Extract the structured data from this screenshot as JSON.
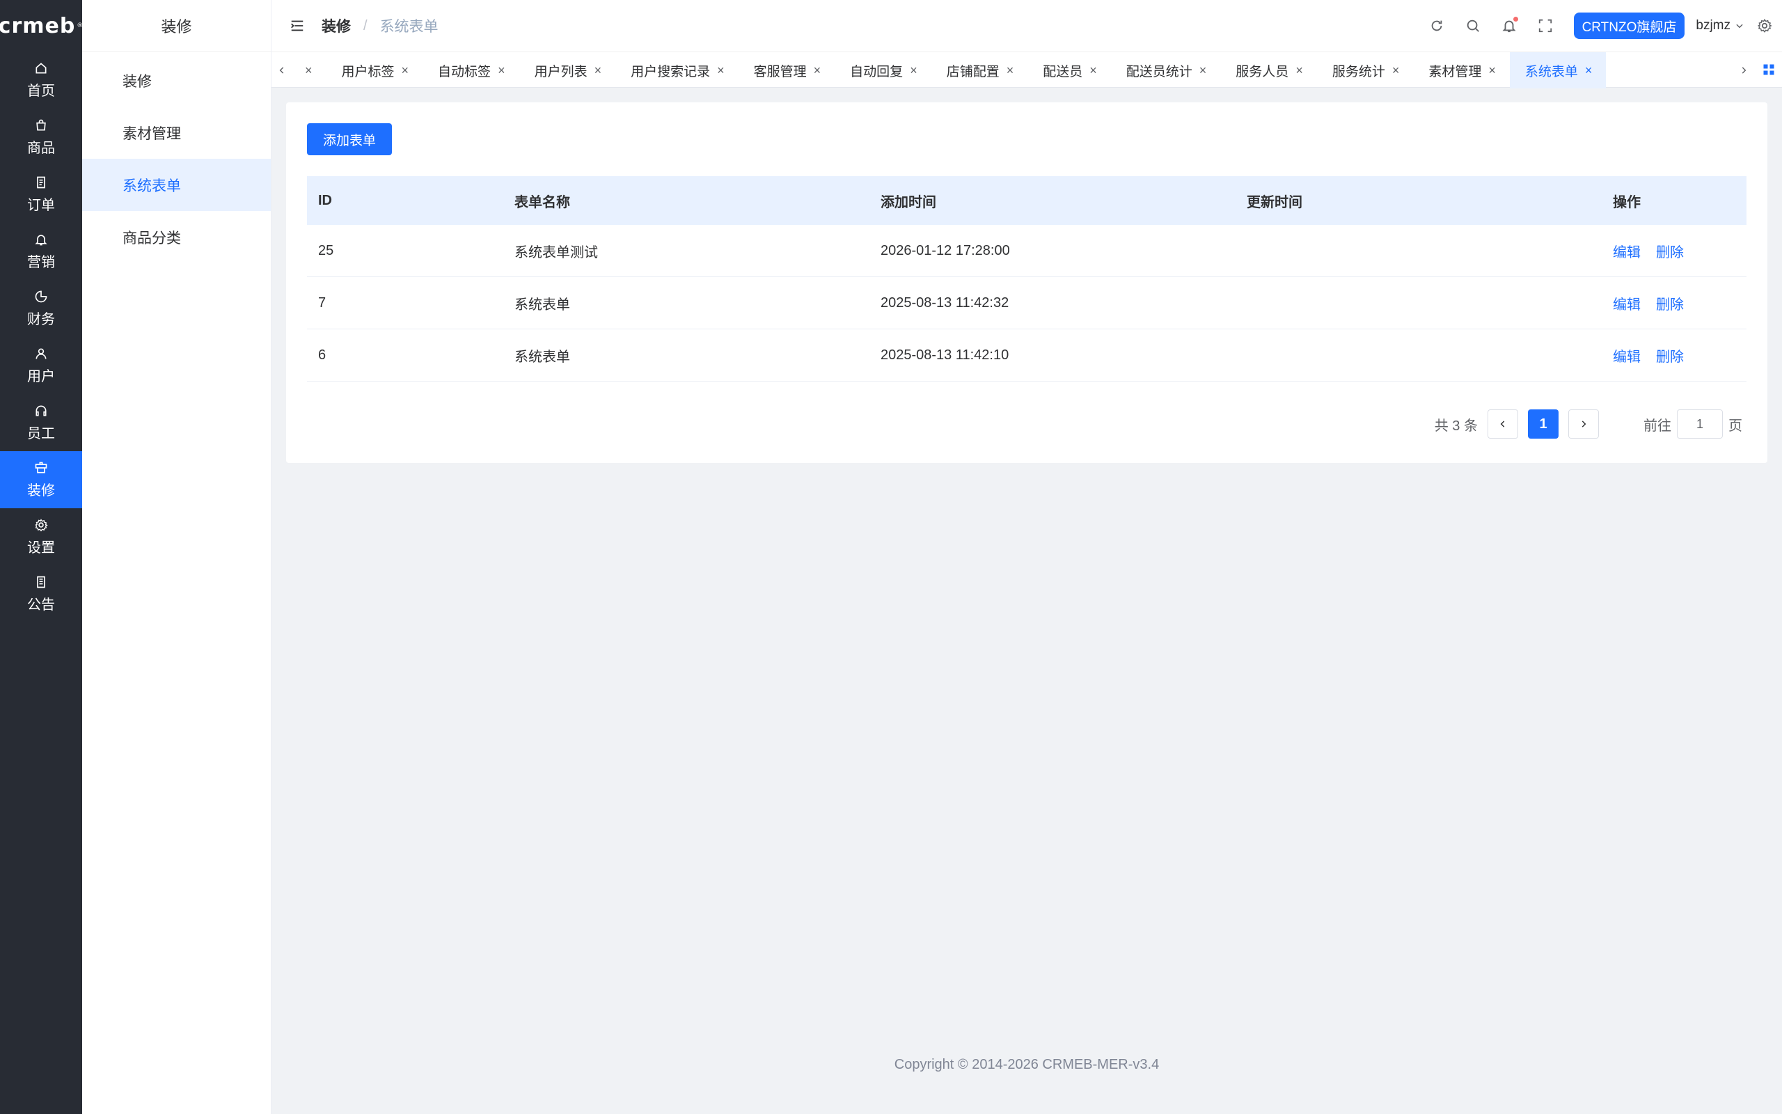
{
  "logo": {
    "text": "crmeb",
    "mark": "®"
  },
  "nav": [
    {
      "label": "首页",
      "icon": "home-icon"
    },
    {
      "label": "商品",
      "icon": "bag-icon"
    },
    {
      "label": "订单",
      "icon": "order-icon"
    },
    {
      "label": "营销",
      "icon": "bell-icon"
    },
    {
      "label": "财务",
      "icon": "pie-icon"
    },
    {
      "label": "用户",
      "icon": "user-icon"
    },
    {
      "label": "员工",
      "icon": "headset-icon"
    },
    {
      "label": "装修",
      "icon": "decor-icon",
      "active": true
    },
    {
      "label": "设置",
      "icon": "gear-icon"
    },
    {
      "label": "公告",
      "icon": "notice-icon"
    }
  ],
  "subnav": {
    "title": "装修",
    "items": [
      "装修",
      "素材管理",
      "系统表单",
      "商品分类"
    ],
    "active": "系统表单"
  },
  "breadcrumb": {
    "parent": "装修",
    "separator": "/",
    "current": "系统表单"
  },
  "header": {
    "store": "CRTNZO旗舰店",
    "user": "bzjmz"
  },
  "tabs": [
    "",
    "用户标签",
    "自动标签",
    "用户列表",
    "用户搜索记录",
    "客服管理",
    "自动回复",
    "店铺配置",
    "配送员",
    "配送员统计",
    "服务人员",
    "服务统计",
    "素材管理",
    "系统表单"
  ],
  "active_tab": "系统表单",
  "add_button": "添加表单",
  "table": {
    "headers": [
      "ID",
      "表单名称",
      "添加时间",
      "更新时间",
      "操作"
    ],
    "rows": [
      {
        "id": "25",
        "name": "系统表单测试",
        "created": "2026-01-12 17:28:00",
        "updated": ""
      },
      {
        "id": "7",
        "name": "系统表单",
        "created": "2025-08-13 11:42:32",
        "updated": ""
      },
      {
        "id": "6",
        "name": "系统表单",
        "created": "2025-08-13 11:42:10",
        "updated": ""
      }
    ],
    "edit_label": "编辑",
    "delete_label": "删除"
  },
  "pagination": {
    "total": "共 3 条",
    "current": "1",
    "goto_label": "前往",
    "goto_value": "1",
    "page_suffix": "页"
  },
  "footer": "Copyright © 2014-2026 CRMEB-MER-v3.4",
  "colors": {
    "primary": "#1e6fff",
    "sidebar": "#282c34",
    "header_row": "#e8f1ff"
  }
}
